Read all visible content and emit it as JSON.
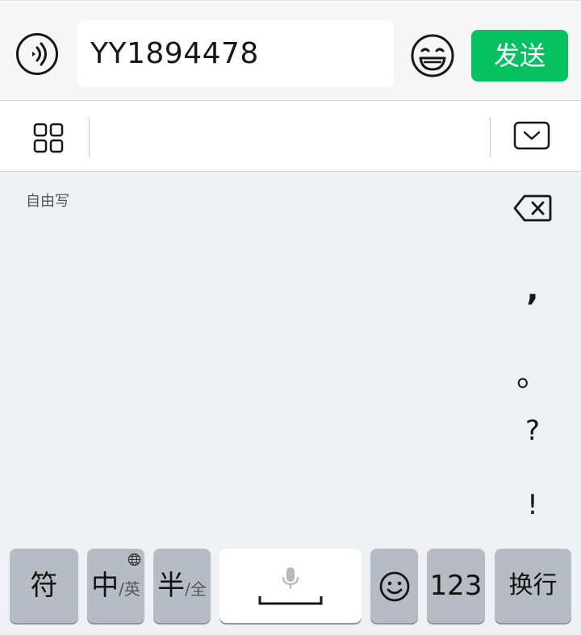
{
  "input_bar": {
    "voice_icon": "voice-wave-icon",
    "text_value": "YY1894478",
    "emoji_icon": "emoji-face-icon",
    "send_label": "发送"
  },
  "toolbar": {
    "grid_icon": "apps-grid-icon",
    "collapse_icon": "keyboard-collapse-icon"
  },
  "handwriting": {
    "mode_label": "自由写",
    "delete_icon": "backspace-icon",
    "punctuation": [
      ",",
      "。",
      "?",
      "!"
    ]
  },
  "keys": {
    "symbol": "符",
    "cn_main": "中",
    "cn_sub": "/英",
    "half_main": "半",
    "half_sub": "/全",
    "number": "123",
    "enter": "换行"
  },
  "colors": {
    "send_green": "#07c160",
    "keyboard_bg": "#eff0f4",
    "function_key": "#b7bcc4"
  }
}
